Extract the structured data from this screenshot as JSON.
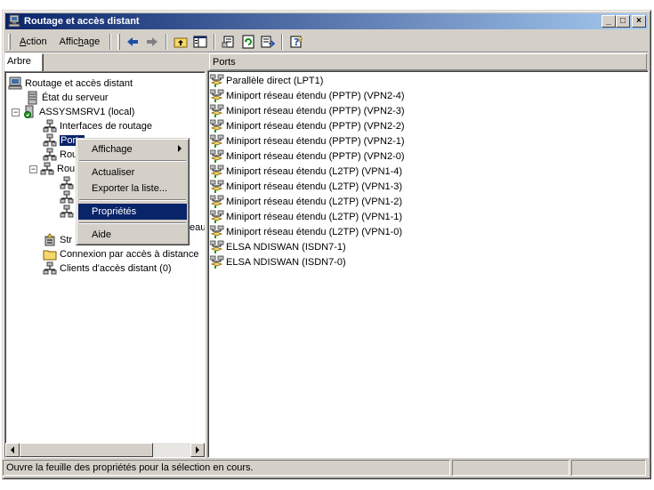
{
  "window": {
    "title": "Routage et accès distant",
    "controls": {
      "minimize": "_",
      "maximize": "□",
      "close": "×"
    }
  },
  "menu": {
    "action": {
      "prefix": "",
      "accel": "A",
      "rest": "ction"
    },
    "view": {
      "prefix": "Affic",
      "accel": "h",
      "rest": "age"
    }
  },
  "toolbar_icons": [
    "back-arrow-icon",
    "forward-arrow-icon",
    "up-folder-icon",
    "show-hide-tree-icon",
    "properties-icon",
    "refresh-icon",
    "export-list-icon",
    "help-icon"
  ],
  "left_pane": {
    "tab_label": "Arbre",
    "tree": [
      {
        "label": "Routage et accès distant",
        "icon": "computer-icon"
      },
      {
        "label": "État du serveur",
        "icon": "server-icon"
      },
      {
        "label": "ASSYSMSRV1 (local)",
        "icon": "server-green-icon"
      },
      {
        "label": "Interfaces de routage",
        "icon": "network-icon"
      },
      {
        "label": "Ports",
        "icon": "network-icon"
      },
      {
        "label": "Rou",
        "icon": "network-icon"
      },
      {
        "label": "Rou",
        "icon": "network-icon"
      },
      {
        "label": "",
        "icon": "network-icon"
      },
      {
        "label": "",
        "icon": "network-icon"
      },
      {
        "label": "",
        "icon": "network-icon"
      },
      {
        "label": "eau",
        "icon": ""
      },
      {
        "label": "Str",
        "icon": "policy-icon"
      },
      {
        "label": "Connexion par accès à distance",
        "icon": "folder-icon"
      },
      {
        "label": "Clients d'accès distant (0)",
        "icon": "network-icon"
      }
    ]
  },
  "right_pane": {
    "header": "Ports",
    "ports": [
      "Parallèle direct (LPT1)",
      "Miniport réseau étendu (PPTP) (VPN2-4)",
      "Miniport réseau étendu (PPTP) (VPN2-3)",
      "Miniport réseau étendu (PPTP) (VPN2-2)",
      "Miniport réseau étendu (PPTP) (VPN2-1)",
      "Miniport réseau étendu (PPTP) (VPN2-0)",
      "Miniport réseau étendu (L2TP) (VPN1-4)",
      "Miniport réseau étendu (L2TP) (VPN1-3)",
      "Miniport réseau étendu (L2TP) (VPN1-2)",
      "Miniport réseau étendu (L2TP) (VPN1-1)",
      "Miniport réseau étendu (L2TP) (VPN1-0)",
      "ELSA NDISWAN (ISDN7-1)",
      "ELSA NDISWAN (ISDN7-0)"
    ]
  },
  "context_menu": {
    "view": "Affichage",
    "refresh": "Actualiser",
    "export": "Exporter la liste...",
    "properties": "Propriétés",
    "help": "Aide"
  },
  "status_bar": {
    "text": "Ouvre la feuille des propriétés pour la sélection en cours."
  },
  "colors": {
    "title_start": "#0a246a",
    "title_end": "#a6caf0",
    "selection": "#0a246a",
    "face": "#d4d0c8"
  }
}
